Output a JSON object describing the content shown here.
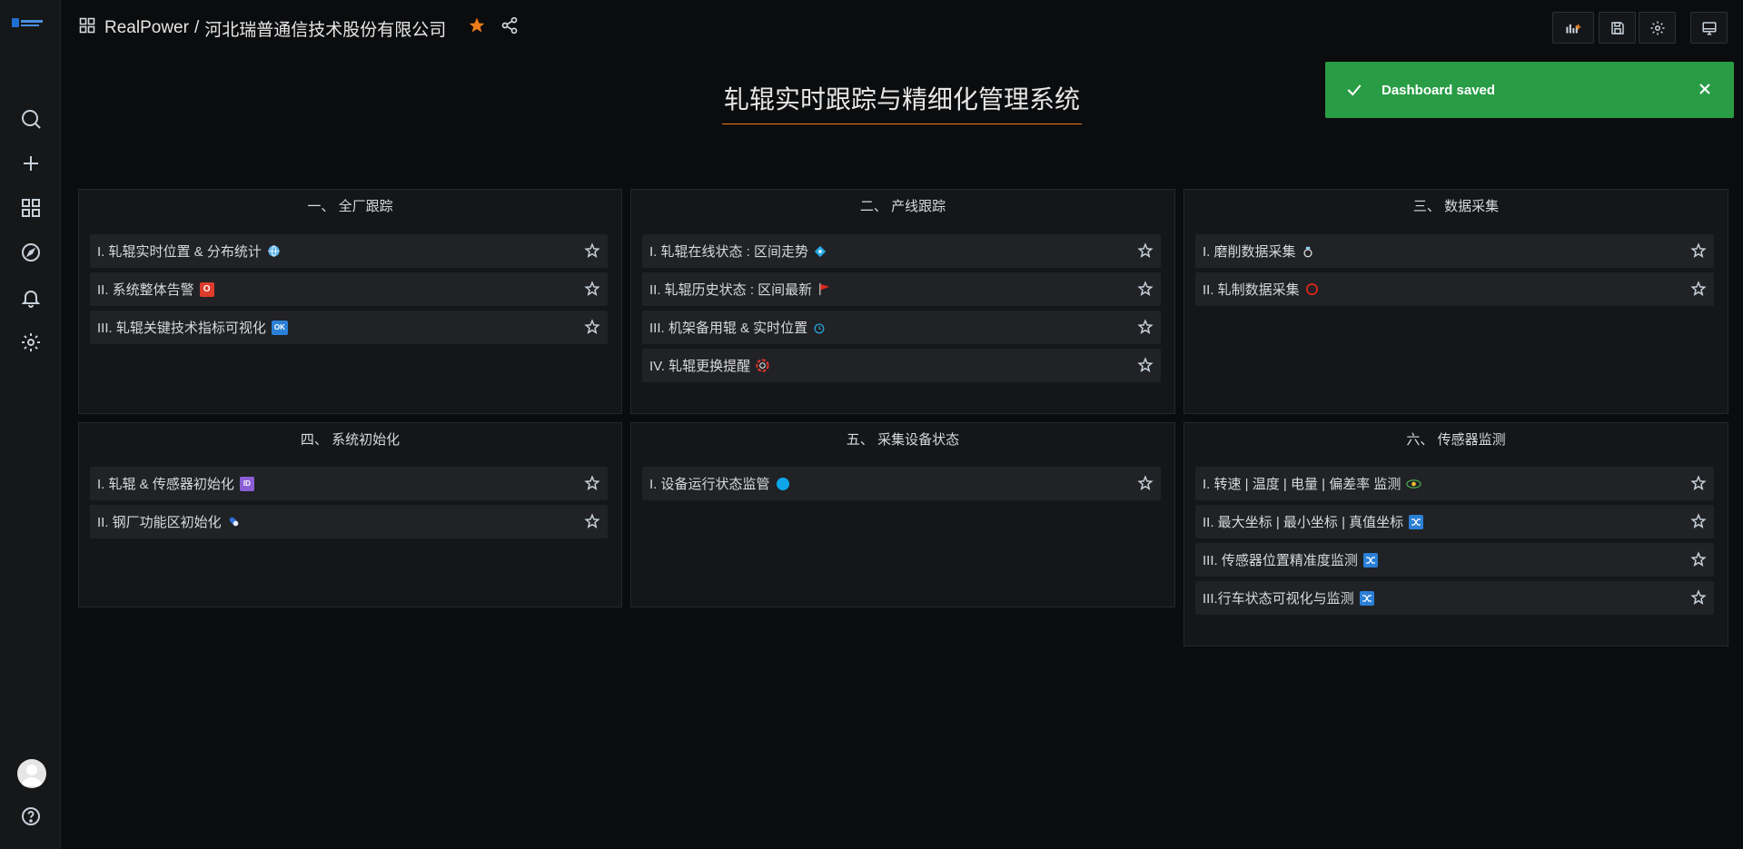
{
  "breadcrumb": {
    "org": "RealPower",
    "separator": "/",
    "dashboard": "河北瑞普通信技术股份有限公司"
  },
  "toast": {
    "message": "Dashboard saved",
    "color": "#299c46"
  },
  "title": "轧辊实时跟踪与精细化管理系统",
  "panels": [
    {
      "title": "一、 全厂跟踪",
      "items": [
        {
          "label": "I. 轧辊实时位置 & 分布统计",
          "icon": "globe-icon"
        },
        {
          "label": "II. 系统整体告警",
          "icon": "o-button-icon"
        },
        {
          "label": "III. 轧辊关键技术指标可视化",
          "icon": "ok-button-icon"
        }
      ]
    },
    {
      "title": "二、 产线跟踪",
      "items": [
        {
          "label": "I. 轧辊在线状态 : 区间走势",
          "icon": "diamond-dots-icon"
        },
        {
          "label": "II. 轧辊历史状态 : 区间最新",
          "icon": "red-flag-icon"
        },
        {
          "label": "III. 机架备用辊 & 实时位置",
          "icon": "alarm-clock-icon"
        },
        {
          "label": "IV. 轧辊更换提醒",
          "icon": "lifebuoy-icon"
        }
      ]
    },
    {
      "title": "三、 数据采集",
      "items": [
        {
          "label": "I. 磨削数据采集",
          "icon": "ring-icon"
        },
        {
          "label": "II. 轧制数据采集",
          "icon": "red-circle-icon"
        }
      ]
    },
    {
      "title": "四、 系统初始化",
      "items": [
        {
          "label": "I. 轧辊 & 传感器初始化",
          "icon": "id-button-icon"
        },
        {
          "label": "II. 钢厂功能区初始化",
          "icon": "capsule-icon"
        }
      ]
    },
    {
      "title": "五、 采集设备状态",
      "items": [
        {
          "label": "I. 设备运行状态监管",
          "icon": "blue-circle-icon"
        }
      ]
    },
    {
      "title": "六、 传感器监测",
      "items": [
        {
          "label": "I. 转速 | 温度 | 电量 | 偏差率 监测",
          "icon": "eye-icon"
        },
        {
          "label": "II. 最大坐标 | 最小坐标 | 真值坐标",
          "icon": "shuffle-icon"
        },
        {
          "label": "III. 传感器位置精准度监测",
          "icon": "shuffle-icon"
        },
        {
          "label": "III.行车状态可视化与监测",
          "icon": "shuffle-icon"
        }
      ]
    }
  ]
}
